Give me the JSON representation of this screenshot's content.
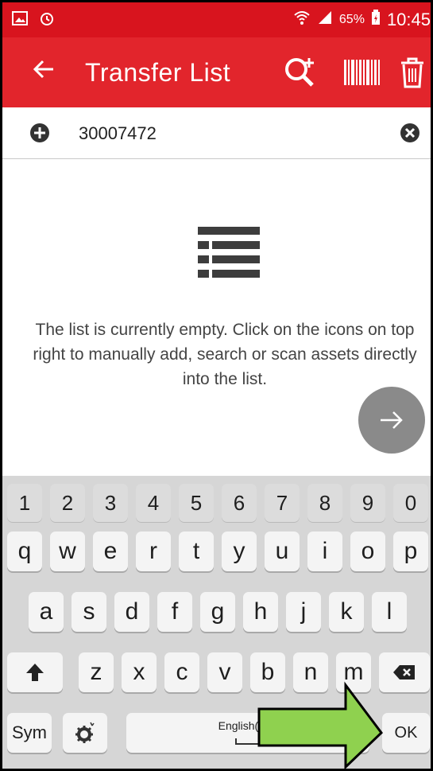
{
  "status_bar": {
    "battery_percent": "65%",
    "time": "10:45",
    "icons": [
      "gallery-icon",
      "alarm-icon",
      "wifi-icon",
      "signal-icon",
      "battery-icon"
    ]
  },
  "app_bar": {
    "title": "Transfer List",
    "actions": [
      "back-arrow-icon",
      "search-add-icon",
      "barcode-icon",
      "trash-icon"
    ],
    "color": "#e2252c"
  },
  "input": {
    "value": "30007472",
    "placeholder": ""
  },
  "empty_state": {
    "message": "The list is currently empty. Click on the icons on top right to manually add, search or scan assets directly into the list.",
    "icon": "list-icon"
  },
  "keyboard": {
    "numbers": [
      "1",
      "2",
      "3",
      "4",
      "5",
      "6",
      "7",
      "8",
      "9",
      "0"
    ],
    "row1": [
      "q",
      "w",
      "e",
      "r",
      "t",
      "y",
      "u",
      "i",
      "o",
      "p"
    ],
    "row2": [
      "a",
      "s",
      "d",
      "f",
      "g",
      "h",
      "j",
      "k",
      "l"
    ],
    "row3": [
      "z",
      "x",
      "c",
      "v",
      "b",
      "n",
      "m"
    ],
    "sym_label": "Sym",
    "space_label": "English(UK)",
    "ok_label": "OK"
  },
  "overlay": {
    "arrow_color": "#8fd14f"
  }
}
